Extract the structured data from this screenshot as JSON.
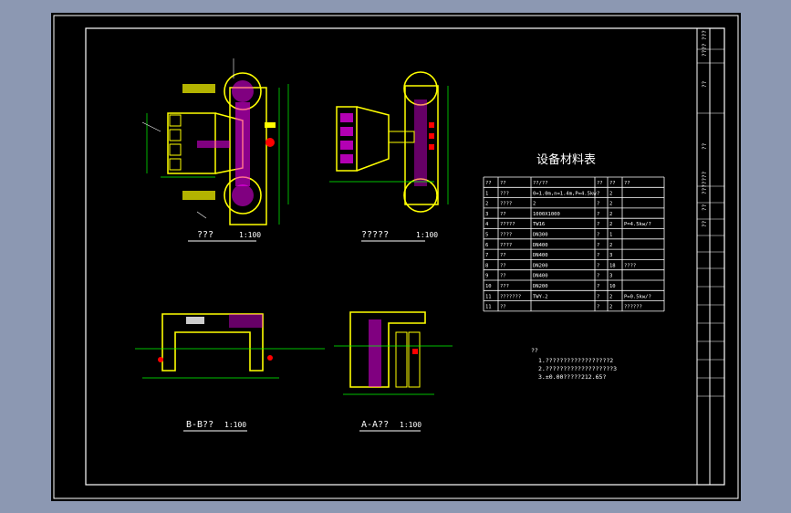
{
  "views": {
    "plan": {
      "title": "???",
      "scale": "1:100"
    },
    "plan2": {
      "title": "?????",
      "scale": "1:100"
    },
    "section_bb": {
      "title": "B-B??",
      "scale": "1:100"
    },
    "section_aa": {
      "title": "A-A??",
      "scale": "1:100"
    }
  },
  "table": {
    "title": "设备材料表",
    "headers": [
      "??",
      "??",
      "??/??",
      "??",
      "??",
      "??"
    ],
    "rows": [
      [
        "1",
        "???",
        "0=1.0m,n=1.4m,P=4.5kw",
        "?",
        "2",
        ""
      ],
      [
        "2",
        "????",
        "2",
        "?",
        "2",
        ""
      ],
      [
        "3",
        "??",
        "1000X1000",
        "?",
        "2",
        ""
      ],
      [
        "4",
        "?????",
        "TW16",
        "?",
        "2",
        "P=4.5kw/?"
      ],
      [
        "5",
        "????",
        "DN300",
        "?",
        "1",
        ""
      ],
      [
        "6",
        "????",
        "DN400",
        "?",
        "2",
        ""
      ],
      [
        "7",
        "??",
        "DN400",
        "?",
        "3",
        ""
      ],
      [
        "8",
        "??",
        "DN200",
        "?",
        "18",
        "????"
      ],
      [
        "9",
        "??",
        "DN400",
        "?",
        "3",
        ""
      ],
      [
        "10",
        "???",
        "DN200",
        "?",
        "10",
        ""
      ],
      [
        "11",
        "???????",
        "TWY-2",
        "?",
        "2",
        "P=0.5kw/?"
      ],
      [
        "11",
        "??",
        "",
        "?",
        "2",
        "??????"
      ]
    ]
  },
  "notes": {
    "heading": "??",
    "lines": [
      "1.??????????????????2",
      "2.???????????????????3",
      "3.±0.00?????212.65?"
    ]
  },
  "title_block": [
    "???",
    "????",
    "??",
    "??",
    "???????",
    "??",
    "??"
  ],
  "colors": {
    "background": "#8c98b2",
    "sheet": "#000000",
    "line_white": "#ffffff",
    "wall_yellow": "#ffff00",
    "dim_green": "#00ff00",
    "hatch_magenta": "#ff00ff",
    "accent_red": "#ff0000",
    "cyan": "#00ffff"
  }
}
